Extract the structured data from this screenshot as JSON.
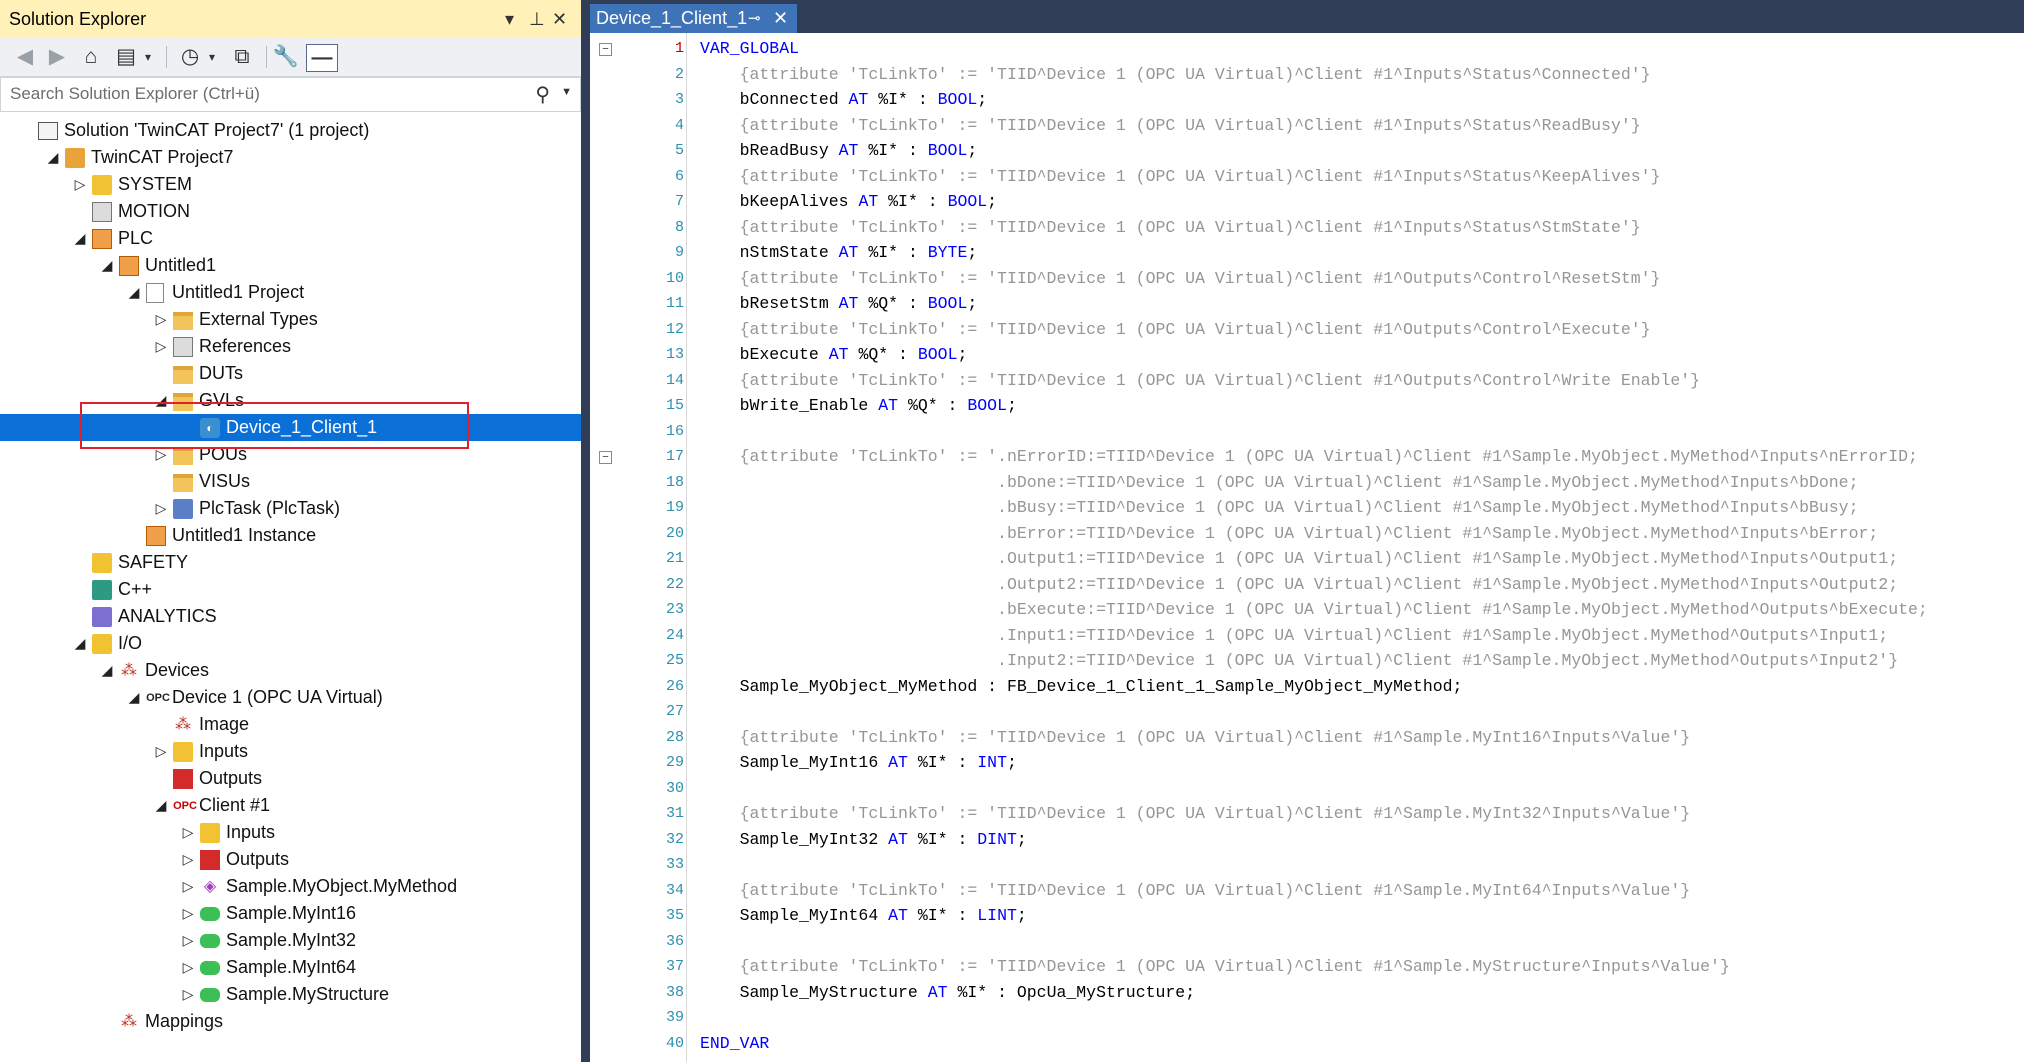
{
  "solution_explorer": {
    "title": "Solution Explorer",
    "title_controls": [
      "▾",
      "⊥",
      "✕"
    ],
    "search_placeholder": "Search Solution Explorer (Ctrl+ü)",
    "tree": [
      {
        "label": "Solution 'TwinCAT Project7' (1 project)",
        "icon": "solution-icon",
        "arrow": ""
      },
      {
        "label": "TwinCAT Project7",
        "icon": "twincat-project-icon",
        "arrow": "open"
      },
      {
        "label": "SYSTEM",
        "icon": "system-icon",
        "arrow": "closed"
      },
      {
        "label": "MOTION",
        "icon": "motion-icon",
        "arrow": ""
      },
      {
        "label": "PLC",
        "icon": "plc-icon",
        "arrow": "open"
      },
      {
        "label": "Untitled1",
        "icon": "plc-project-icon",
        "arrow": "open"
      },
      {
        "label": "Untitled1 Project",
        "icon": "plc-subproject-icon",
        "arrow": "open"
      },
      {
        "label": "External Types",
        "icon": "folder-icon",
        "arrow": "closed"
      },
      {
        "label": "References",
        "icon": "references-icon",
        "arrow": "closed"
      },
      {
        "label": "DUTs",
        "icon": "folder-icon",
        "arrow": ""
      },
      {
        "label": "GVLs",
        "icon": "folder-icon",
        "arrow": "open"
      },
      {
        "label": "Device_1_Client_1",
        "icon": "gvl-icon",
        "arrow": "",
        "selected": true
      },
      {
        "label": "POUs",
        "icon": "folder-icon",
        "arrow": "closed"
      },
      {
        "label": "VISUs",
        "icon": "folder-icon",
        "arrow": ""
      },
      {
        "label": "PlcTask (PlcTask)",
        "icon": "task-icon",
        "arrow": "closed"
      },
      {
        "label": "Untitled1 Instance",
        "icon": "instance-icon",
        "arrow": ""
      },
      {
        "label": "SAFETY",
        "icon": "safety-icon",
        "arrow": ""
      },
      {
        "label": "C++",
        "icon": "cpp-icon",
        "arrow": ""
      },
      {
        "label": "ANALYTICS",
        "icon": "analytics-icon",
        "arrow": ""
      },
      {
        "label": "I/O",
        "icon": "io-icon",
        "arrow": "open"
      },
      {
        "label": "Devices",
        "icon": "devices-icon",
        "arrow": "open"
      },
      {
        "label": "Device 1 (OPC UA Virtual)",
        "icon": "opc-device-icon",
        "arrow": "open"
      },
      {
        "label": "Image",
        "icon": "image-icon",
        "arrow": ""
      },
      {
        "label": "Inputs",
        "icon": "inputs-icon",
        "arrow": "closed"
      },
      {
        "label": "Outputs",
        "icon": "outputs-icon",
        "arrow": ""
      },
      {
        "label": "Client #1",
        "icon": "opc-client-icon",
        "arrow": "open"
      },
      {
        "label": "Inputs",
        "icon": "inputs-icon",
        "arrow": "closed"
      },
      {
        "label": "Outputs",
        "icon": "outputs-icon",
        "arrow": "closed"
      },
      {
        "label": "Sample.MyObject.MyMethod",
        "icon": "method-icon",
        "arrow": "closed"
      },
      {
        "label": "Sample.MyInt16",
        "icon": "variable-icon",
        "arrow": "closed"
      },
      {
        "label": "Sample.MyInt32",
        "icon": "variable-icon",
        "arrow": "closed"
      },
      {
        "label": "Sample.MyInt64",
        "icon": "variable-icon",
        "arrow": "closed"
      },
      {
        "label": "Sample.MyStructure",
        "icon": "variable-icon",
        "arrow": "closed"
      },
      {
        "label": "Mappings",
        "icon": "mappings-icon",
        "arrow": ""
      }
    ]
  },
  "editor": {
    "tab_label": "Device_1_Client_1",
    "tab_pin": "⊸",
    "tab_close": "✕",
    "lines": [
      [
        {
          "t": "VAR_GLOBAL",
          "c": "kw"
        }
      ],
      [
        {
          "t": "    {attribute 'TcLinkTo' := 'TIID^Device 1 (OPC UA Virtual)^Client #1^Inputs^Status^Connected'}",
          "c": "cm"
        }
      ],
      [
        {
          "t": "    bConnected ",
          "c": "id"
        },
        {
          "t": "AT",
          "c": "kw"
        },
        {
          "t": " %I* : ",
          "c": "id"
        },
        {
          "t": "BOOL",
          "c": "kw"
        },
        {
          "t": ";",
          "c": "id"
        }
      ],
      [
        {
          "t": "    {attribute 'TcLinkTo' := 'TIID^Device 1 (OPC UA Virtual)^Client #1^Inputs^Status^ReadBusy'}",
          "c": "cm"
        }
      ],
      [
        {
          "t": "    bReadBusy ",
          "c": "id"
        },
        {
          "t": "AT",
          "c": "kw"
        },
        {
          "t": " %I* : ",
          "c": "id"
        },
        {
          "t": "BOOL",
          "c": "kw"
        },
        {
          "t": ";",
          "c": "id"
        }
      ],
      [
        {
          "t": "    {attribute 'TcLinkTo' := 'TIID^Device 1 (OPC UA Virtual)^Client #1^Inputs^Status^KeepAlives'}",
          "c": "cm"
        }
      ],
      [
        {
          "t": "    bKeepAlives ",
          "c": "id"
        },
        {
          "t": "AT",
          "c": "kw"
        },
        {
          "t": " %I* : ",
          "c": "id"
        },
        {
          "t": "BOOL",
          "c": "kw"
        },
        {
          "t": ";",
          "c": "id"
        }
      ],
      [
        {
          "t": "    {attribute 'TcLinkTo' := 'TIID^Device 1 (OPC UA Virtual)^Client #1^Inputs^Status^StmState'}",
          "c": "cm"
        }
      ],
      [
        {
          "t": "    nStmState ",
          "c": "id"
        },
        {
          "t": "AT",
          "c": "kw"
        },
        {
          "t": " %I* : ",
          "c": "id"
        },
        {
          "t": "BYTE",
          "c": "kw"
        },
        {
          "t": ";",
          "c": "id"
        }
      ],
      [
        {
          "t": "    {attribute 'TcLinkTo' := 'TIID^Device 1 (OPC UA Virtual)^Client #1^Outputs^Control^ResetStm'}",
          "c": "cm"
        }
      ],
      [
        {
          "t": "    bResetStm ",
          "c": "id"
        },
        {
          "t": "AT",
          "c": "kw"
        },
        {
          "t": " %Q* : ",
          "c": "id"
        },
        {
          "t": "BOOL",
          "c": "kw"
        },
        {
          "t": ";",
          "c": "id"
        }
      ],
      [
        {
          "t": "    {attribute 'TcLinkTo' := 'TIID^Device 1 (OPC UA Virtual)^Client #1^Outputs^Control^Execute'}",
          "c": "cm"
        }
      ],
      [
        {
          "t": "    bExecute ",
          "c": "id"
        },
        {
          "t": "AT",
          "c": "kw"
        },
        {
          "t": " %Q* : ",
          "c": "id"
        },
        {
          "t": "BOOL",
          "c": "kw"
        },
        {
          "t": ";",
          "c": "id"
        }
      ],
      [
        {
          "t": "    {attribute 'TcLinkTo' := 'TIID^Device 1 (OPC UA Virtual)^Client #1^Outputs^Control^Write Enable'}",
          "c": "cm"
        }
      ],
      [
        {
          "t": "    bWrite_Enable ",
          "c": "id"
        },
        {
          "t": "AT",
          "c": "kw"
        },
        {
          "t": " %Q* : ",
          "c": "id"
        },
        {
          "t": "BOOL",
          "c": "kw"
        },
        {
          "t": ";",
          "c": "id"
        }
      ],
      [],
      [
        {
          "t": "    {attribute 'TcLinkTo' := '.nErrorID:=TIID^Device 1 (OPC UA Virtual)^Client #1^Sample.MyObject.MyMethod^Inputs^nErrorID;",
          "c": "cm"
        }
      ],
      [
        {
          "t": "                              .bDone:=TIID^Device 1 (OPC UA Virtual)^Client #1^Sample.MyObject.MyMethod^Inputs^bDone;",
          "c": "cm"
        }
      ],
      [
        {
          "t": "                              .bBusy:=TIID^Device 1 (OPC UA Virtual)^Client #1^Sample.MyObject.MyMethod^Inputs^bBusy;",
          "c": "cm"
        }
      ],
      [
        {
          "t": "                              .bError:=TIID^Device 1 (OPC UA Virtual)^Client #1^Sample.MyObject.MyMethod^Inputs^bError;",
          "c": "cm"
        }
      ],
      [
        {
          "t": "                              .Output1:=TIID^Device 1 (OPC UA Virtual)^Client #1^Sample.MyObject.MyMethod^Inputs^Output1;",
          "c": "cm"
        }
      ],
      [
        {
          "t": "                              .Output2:=TIID^Device 1 (OPC UA Virtual)^Client #1^Sample.MyObject.MyMethod^Inputs^Output2;",
          "c": "cm"
        }
      ],
      [
        {
          "t": "                              .bExecute:=TIID^Device 1 (OPC UA Virtual)^Client #1^Sample.MyObject.MyMethod^Outputs^bExecute;",
          "c": "cm"
        }
      ],
      [
        {
          "t": "                              .Input1:=TIID^Device 1 (OPC UA Virtual)^Client #1^Sample.MyObject.MyMethod^Outputs^Input1;",
          "c": "cm"
        }
      ],
      [
        {
          "t": "                              .Input2:=TIID^Device 1 (OPC UA Virtual)^Client #1^Sample.MyObject.MyMethod^Outputs^Input2'}",
          "c": "cm"
        }
      ],
      [
        {
          "t": "    Sample_MyObject_MyMethod : FB_Device_1_Client_1_Sample_MyObject_MyMethod;",
          "c": "id"
        }
      ],
      [],
      [
        {
          "t": "    {attribute 'TcLinkTo' := 'TIID^Device 1 (OPC UA Virtual)^Client #1^Sample.MyInt16^Inputs^Value'}",
          "c": "cm"
        }
      ],
      [
        {
          "t": "    Sample_MyInt16 ",
          "c": "id"
        },
        {
          "t": "AT",
          "c": "kw"
        },
        {
          "t": " %I* : ",
          "c": "id"
        },
        {
          "t": "INT",
          "c": "kw"
        },
        {
          "t": ";",
          "c": "id"
        }
      ],
      [],
      [
        {
          "t": "    {attribute 'TcLinkTo' := 'TIID^Device 1 (OPC UA Virtual)^Client #1^Sample.MyInt32^Inputs^Value'}",
          "c": "cm"
        }
      ],
      [
        {
          "t": "    Sample_MyInt32 ",
          "c": "id"
        },
        {
          "t": "AT",
          "c": "kw"
        },
        {
          "t": " %I* : ",
          "c": "id"
        },
        {
          "t": "DINT",
          "c": "kw"
        },
        {
          "t": ";",
          "c": "id"
        }
      ],
      [],
      [
        {
          "t": "    {attribute 'TcLinkTo' := 'TIID^Device 1 (OPC UA Virtual)^Client #1^Sample.MyInt64^Inputs^Value'}",
          "c": "cm"
        }
      ],
      [
        {
          "t": "    Sample_MyInt64 ",
          "c": "id"
        },
        {
          "t": "AT",
          "c": "kw"
        },
        {
          "t": " %I* : ",
          "c": "id"
        },
        {
          "t": "LINT",
          "c": "kw"
        },
        {
          "t": ";",
          "c": "id"
        }
      ],
      [],
      [
        {
          "t": "    {attribute 'TcLinkTo' := 'TIID^Device 1 (OPC UA Virtual)^Client #1^Sample.MyStructure^Inputs^Value'}",
          "c": "cm"
        }
      ],
      [
        {
          "t": "    Sample_MyStructure ",
          "c": "id"
        },
        {
          "t": "AT",
          "c": "kw"
        },
        {
          "t": " %I* : ",
          "c": "id"
        },
        {
          "t": "OpcUa_MyStructure",
          "c": "id"
        },
        {
          "t": ";",
          "c": "id"
        }
      ],
      [],
      [
        {
          "t": "END_VAR",
          "c": "kw"
        }
      ]
    ],
    "fold_markers": [
      1,
      17
    ],
    "current_line": 1
  },
  "colors": {
    "accent_selection": "#0a6fd6",
    "keyword": "#0000ff",
    "comment": "#969696",
    "highlight_box": "#e0202a"
  }
}
